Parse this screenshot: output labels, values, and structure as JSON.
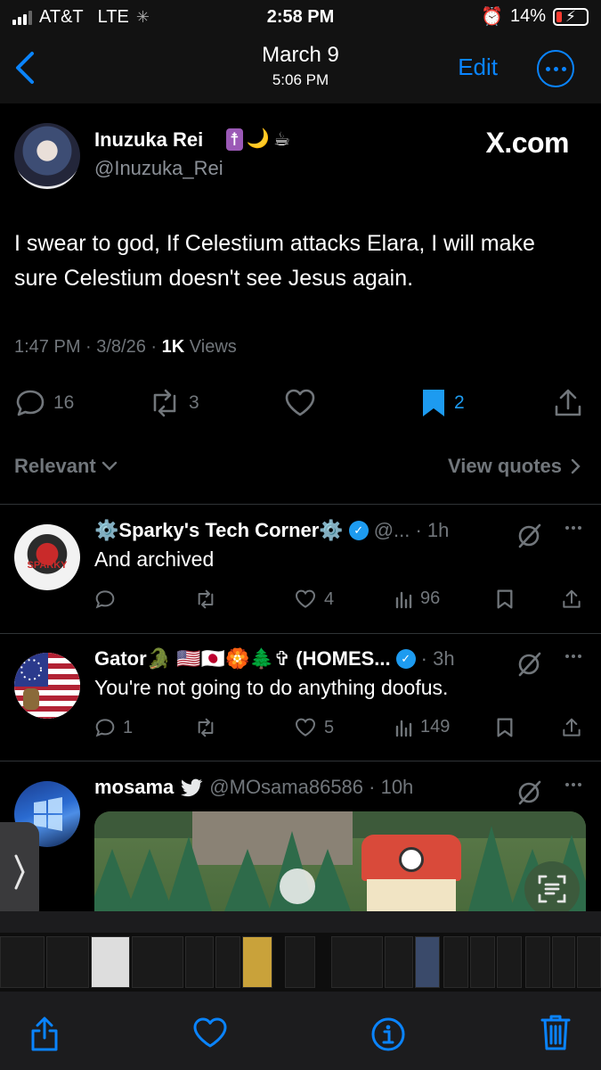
{
  "status_bar": {
    "carrier": "AT&T",
    "network": "LTE",
    "time": "2:58 PM",
    "battery": "14%"
  },
  "photo_header": {
    "title": "March 9",
    "subtitle": "5:06 PM",
    "edit_label": "Edit"
  },
  "main_tweet": {
    "author_name": "Inuzuka Rei",
    "author_emoji": [
      "☨",
      "🌙",
      "☕"
    ],
    "author_handle": "@Inuzuka_Rei",
    "watermark": "X.com",
    "text": "I swear to god, If Celestium attacks Elara, I will make sure Celestium doesn't see Jesus again.",
    "meta_time": "1:47 PM · 3/8/26 · ",
    "meta_views": "1K",
    "meta_views_label": " Views",
    "replies": "16",
    "reposts": "3",
    "bookmarks": "2",
    "sort_label": "Relevant",
    "view_quotes_label": "View quotes"
  },
  "replies": [
    {
      "name": "⚙️Sparky's Tech Corner⚙️",
      "meta": "@... · 1h",
      "text": "And archived",
      "replies": "",
      "likes": "4",
      "views": "96",
      "verified": true,
      "avatar_text": "SPARKY"
    },
    {
      "name": "Gator🐊 🇺🇸🇯🇵🏵️🌲✞ (HOMES...",
      "meta": "· 3h",
      "text": "You're not going to do anything doofus.",
      "replies": "1",
      "likes": "5",
      "views": "149",
      "verified": true
    },
    {
      "name": "mosama",
      "meta": "@MOsama86586 · 10h",
      "text": "",
      "verified": false
    }
  ],
  "colors": {
    "accent": "#0a84ff",
    "x_blue": "#1d9bf0",
    "muted": "#71767b",
    "battery_low": "#ff3b30"
  },
  "icons": [
    "back-icon",
    "more-icon",
    "reply-icon",
    "repost-icon",
    "like-icon",
    "bookmark-icon",
    "share-icon",
    "views-icon",
    "grok-icon",
    "scan-text-icon",
    "heart-icon",
    "info-icon",
    "trash-icon"
  ]
}
